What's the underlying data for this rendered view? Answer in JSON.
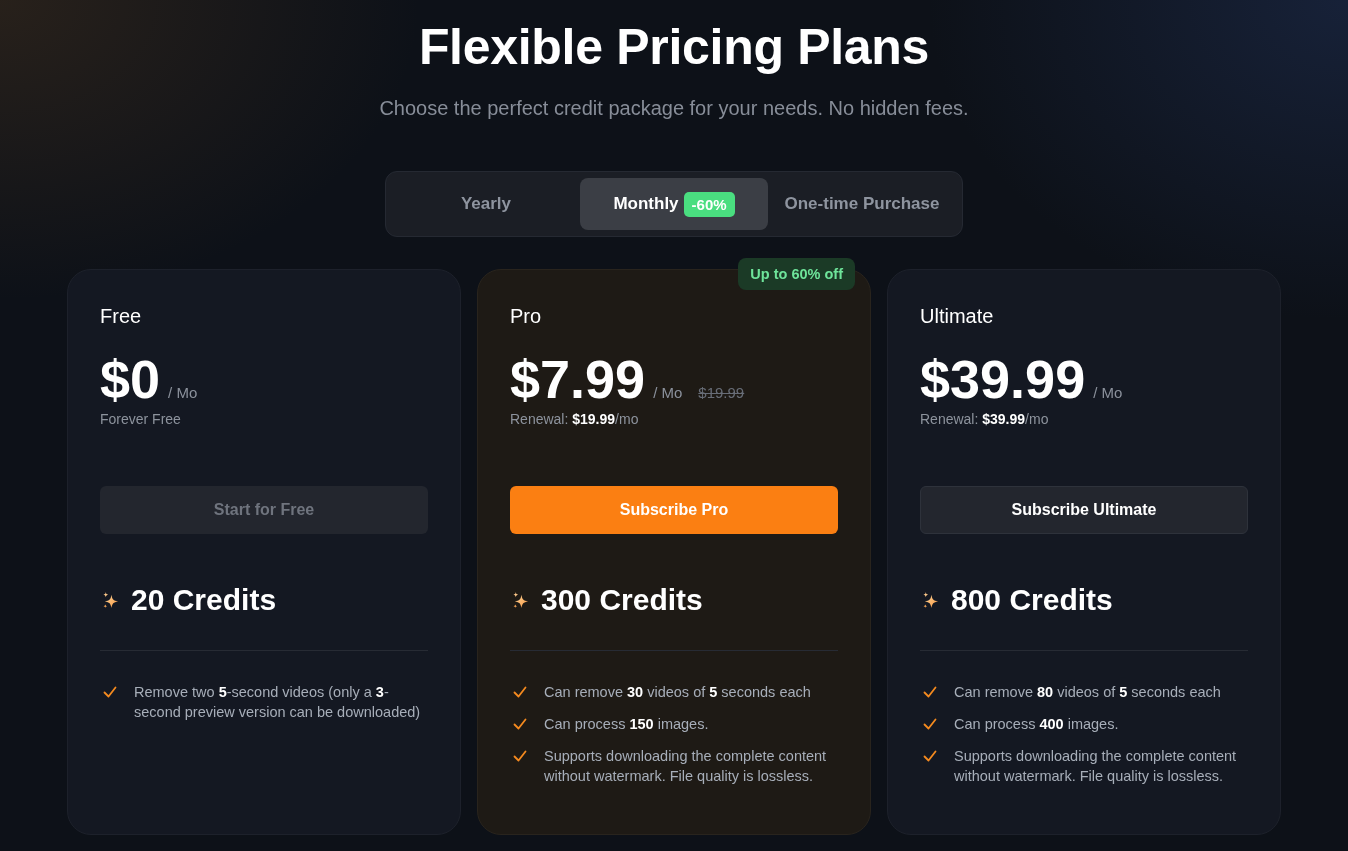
{
  "header": {
    "title": "Flexible Pricing Plans",
    "subtitle": "Choose the perfect credit package for your needs. No hidden fees."
  },
  "billing_tabs": [
    {
      "label": "Yearly",
      "selected": false
    },
    {
      "label": "Monthly",
      "selected": true,
      "badge": "-60%"
    },
    {
      "label": "One-time Purchase",
      "selected": false
    }
  ],
  "plans": [
    {
      "name": "Free",
      "highlighted": false,
      "price": "$0",
      "period": "/ Mo",
      "note": "Forever Free",
      "button": {
        "label": "Start for Free",
        "kind": "muted"
      },
      "credits": "20 Credits",
      "features": [
        "Remove two **5**-second videos (only a **3**-second preview version can be downloaded)"
      ]
    },
    {
      "name": "Pro",
      "highlighted": true,
      "ribbon": "Up to 60% off",
      "price": "$7.99",
      "period": "/ Mo",
      "original_price": "$19.99",
      "note": "Renewal: **$19.99**/mo",
      "button": {
        "label": "Subscribe Pro",
        "kind": "primary"
      },
      "credits": "300 Credits",
      "features": [
        "Can remove **30** videos of **5** seconds each",
        "Can process **150** images.",
        "Supports downloading the complete content without watermark. File quality is lossless."
      ]
    },
    {
      "name": "Ultimate",
      "highlighted": false,
      "price": "$39.99",
      "period": "/ Mo",
      "note": "Renewal: **$39.99**/mo",
      "button": {
        "label": "Subscribe Ultimate",
        "kind": "dark"
      },
      "credits": "800 Credits",
      "features": [
        "Can remove **80** videos of **5** seconds each",
        "Can process **400** images.",
        "Supports downloading the complete content without watermark. File quality is lossless."
      ]
    }
  ]
}
